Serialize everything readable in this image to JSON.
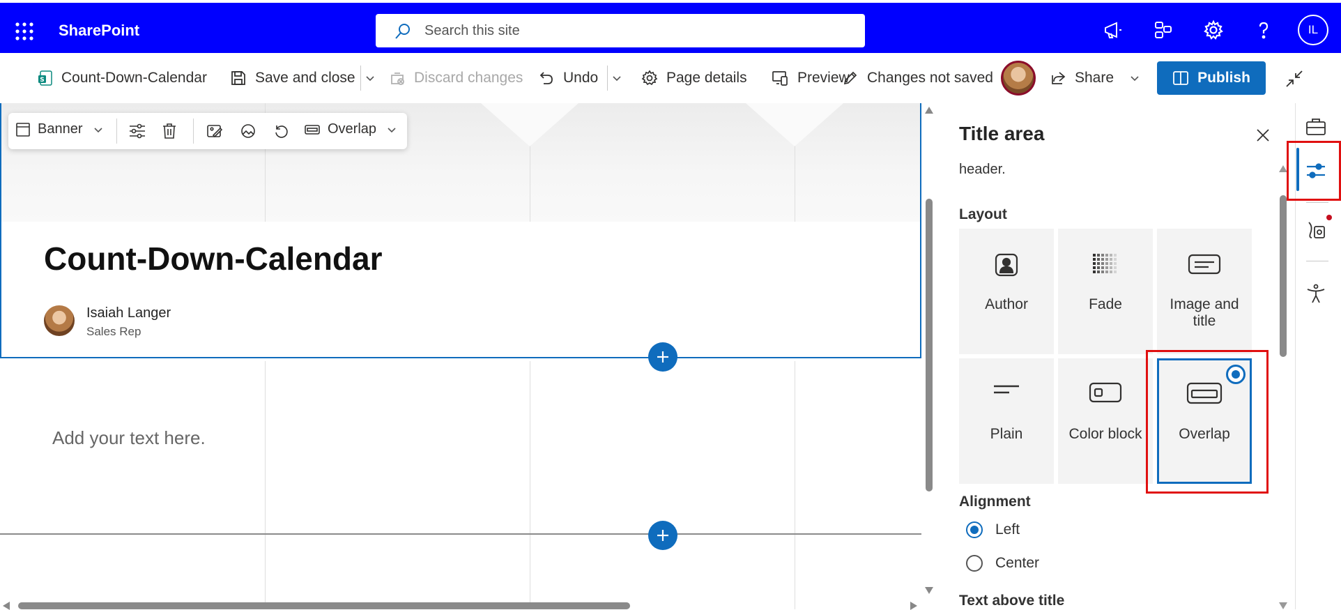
{
  "suite": {
    "brand": "SharePoint",
    "search_placeholder": "Search this site",
    "user_initials": "IL"
  },
  "command_bar": {
    "page_name": "Count-Down-Calendar",
    "save_close": "Save and close",
    "discard": "Discard changes",
    "undo": "Undo",
    "page_details": "Page details",
    "preview": "Preview",
    "status": "Changes not saved",
    "share": "Share",
    "publish": "Publish"
  },
  "title_toolbar": {
    "banner": "Banner",
    "overlap": "Overlap"
  },
  "page": {
    "title": "Count-Down-Calendar",
    "author_name": "Isaiah Langer",
    "author_role": "Sales Rep",
    "text_placeholder": "Add your text here."
  },
  "panel": {
    "title": "Title area",
    "fragment": "header.",
    "layout_label": "Layout",
    "layouts": [
      {
        "label": "Author",
        "selected": false
      },
      {
        "label": "Fade",
        "selected": false
      },
      {
        "label": "Image and title",
        "selected": false
      },
      {
        "label": "Plain",
        "selected": false
      },
      {
        "label": "Color block",
        "selected": false
      },
      {
        "label": "Overlap",
        "selected": true
      }
    ],
    "alignment_label": "Alignment",
    "alignment_options": [
      {
        "label": "Left",
        "selected": true
      },
      {
        "label": "Center",
        "selected": false
      }
    ],
    "text_above_title_label": "Text above title"
  },
  "colors": {
    "suite_bar": "#0000ff",
    "accent": "#0f6cbd",
    "highlight": "#e01010"
  }
}
